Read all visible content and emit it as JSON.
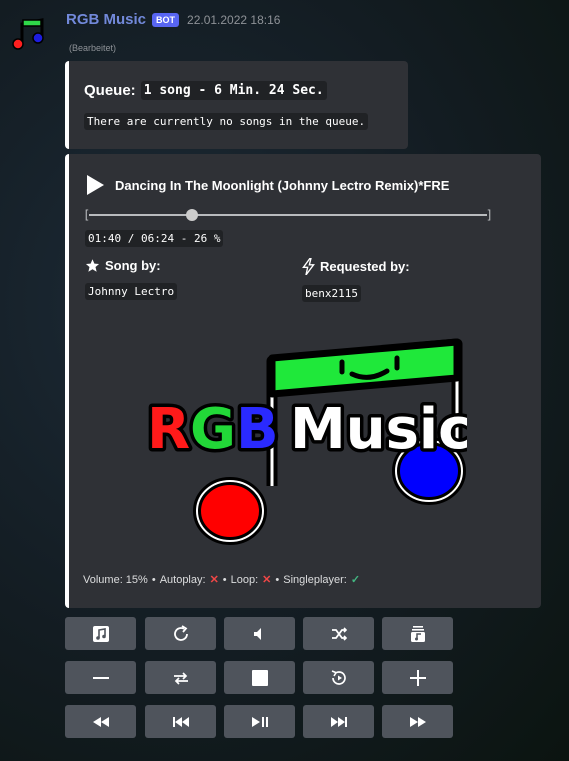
{
  "author": {
    "name": "RGB Music",
    "badge": "BOT",
    "timestamp": "22.01.2022 18:16",
    "edited": "(Bearbeitet)"
  },
  "queue": {
    "label": "Queue:",
    "summary": "1 song - 6 Min. 24 Sec.",
    "empty_text": "There are currently no songs in the queue."
  },
  "now_playing": {
    "title": "Dancing In The Moonlight (Johnny Lectro Remix)*FRE",
    "bar_open": "[",
    "bar_close": "]",
    "progress_fraction": 0.26,
    "timecode": "01:40 / 06:24 - 26 %",
    "song_by_label": "Song by:",
    "song_by_value": "Johnny Lectro",
    "requested_by_label": "Requested by:",
    "requested_by_value": "benx2115"
  },
  "logo": {
    "r": "R",
    "g": "G",
    "b": "B",
    "music": "Music"
  },
  "footer": {
    "volume": "Volume: 15%",
    "sep": "•",
    "autoplay": "Autoplay:",
    "autoplay_state": "✕",
    "loop": "Loop:",
    "loop_state": "✕",
    "singleplayer": "Singleplayer:",
    "singleplayer_state": "✓"
  },
  "colors": {
    "accent": "#ffffff",
    "button": "#4f545c",
    "bot_badge": "#5865f2",
    "name": "#7289da"
  },
  "buttons": [
    [
      "music-note-icon",
      "replay-icon",
      "volume-icon",
      "shuffle-icon",
      "playlist-icon"
    ],
    [
      "minus-icon",
      "loop-icon",
      "stop-icon",
      "rewind-10-icon",
      "plus-icon"
    ],
    [
      "fast-rewind-icon",
      "previous-icon",
      "play-pause-icon",
      "next-icon",
      "fast-forward-icon"
    ]
  ]
}
